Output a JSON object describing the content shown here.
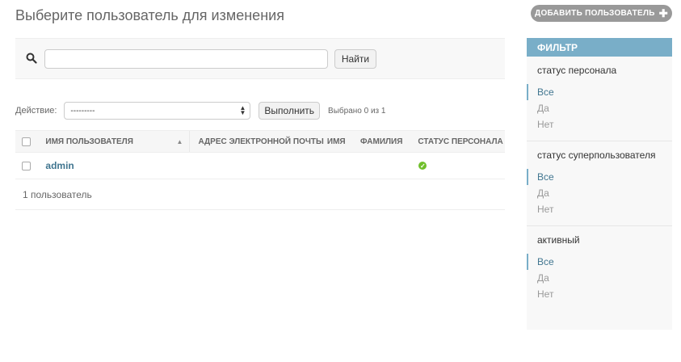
{
  "page": {
    "title": "Выберите пользователь для изменения",
    "add_button": "ДОБАВИТЬ ПОЛЬЗОВАТЕЛЬ"
  },
  "search": {
    "value": "",
    "placeholder": "",
    "button": "Найти",
    "icon": "search-icon"
  },
  "actions": {
    "label": "Действие:",
    "selected_value": "---------",
    "run_button": "Выполнить",
    "selected_count": "Выбрано 0 из 1"
  },
  "table": {
    "columns": [
      "ИМЯ ПОЛЬЗОВАТЕЛЯ",
      "АДРЕС ЭЛЕКТРОННОЙ ПОЧТЫ",
      "ИМЯ",
      "ФАМИЛИЯ",
      "СТАТУС ПЕРСОНАЛА"
    ],
    "rows": [
      {
        "username": "admin",
        "email": "",
        "first_name": "",
        "last_name": "",
        "is_staff": true
      }
    ],
    "paginator": "1 пользователь"
  },
  "filter": {
    "title": "ФИЛЬТР",
    "groups": [
      {
        "title": "статус персонала",
        "options": [
          "Все",
          "Да",
          "Нет"
        ],
        "selected": "Все"
      },
      {
        "title": "статус суперпользователя",
        "options": [
          "Все",
          "Да",
          "Нет"
        ],
        "selected": "Все"
      },
      {
        "title": "активный",
        "options": [
          "Все",
          "Да",
          "Нет"
        ],
        "selected": "Все"
      }
    ]
  },
  "colors": {
    "link": "#417690",
    "filter_header": "#79aec8",
    "add_button": "#999999",
    "status_ok": "#70bf2b"
  }
}
